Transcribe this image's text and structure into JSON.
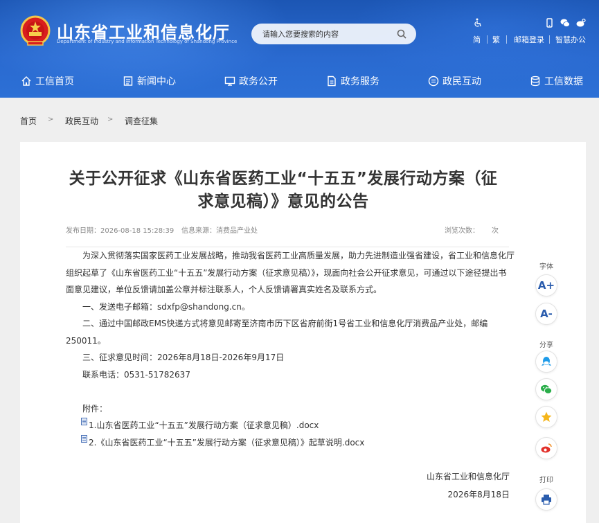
{
  "header": {
    "site_title": "山东省工业和信息化厅",
    "site_subtitle": "Department of Industry and Information Technology of Shandong Province",
    "search_placeholder": "请输入您要搜索的内容",
    "top_links": [
      "简",
      "繁",
      "邮箱登录",
      "智慧办公"
    ],
    "brand_color": "#2a6ad0"
  },
  "nav": {
    "items": [
      "工信首页",
      "新闻中心",
      "政务公开",
      "政务服务",
      "政民互动",
      "工信数据"
    ]
  },
  "breadcrumb": {
    "items": [
      "首页",
      "政民互动",
      "调查征集"
    ],
    "separator": ">"
  },
  "article": {
    "title": "关于公开征求《山东省医药工业“十五五”发展行动方案（征求意见稿）》意见的公告",
    "publish_label": "发布日期：",
    "publish_date": "2026-08-18 15:28:39",
    "source_label": "信息来源：",
    "source": "消费品产业处",
    "views_label": "浏览次数：",
    "views_unit": "次",
    "paragraphs": [
      "为深入贯彻落实国家医药工业发展战略，推动我省医药工业高质量发展，助力先进制造业强省建设，省工业和信息化厅组织起草了《山东省医药工业“十五五”发展行动方案（征求意见稿）》，现面向社会公开征求意见，可通过以下途径提出书面意见建议，单位反馈请加盖公章并标注联系人，个人反馈请署真实姓名及联系方式。",
      "一、发送电子邮箱：sdxfp@shandong.cn。",
      "二、通过中国邮政EMS快递方式将意见邮寄至济南市历下区省府前街1号省工业和信息化厅消费品产业处，邮编250011。",
      "三、征求意见时间：2026年8月18日-2026年9月17日",
      "联系电话：0531-51782637"
    ],
    "attachments_label": "附件：",
    "attachments": [
      "1.山东省医药工业“十五五”发展行动方案（征求意见稿）.docx",
      "2.《山东省医药工业“十五五”发展行动方案（征求意见稿）》起草说明.docx"
    ],
    "signature_org": "山东省工业和信息化厅",
    "signature_date": "2026年8月18日"
  },
  "toolbar": {
    "font_label": "字体",
    "font_increase": "A+",
    "font_decrease": "A-",
    "share_label": "分享",
    "print_label": "打印",
    "icons": [
      "qq-icon",
      "wechat-icon",
      "favorite-icon",
      "weibo-icon",
      "printer-icon"
    ]
  }
}
